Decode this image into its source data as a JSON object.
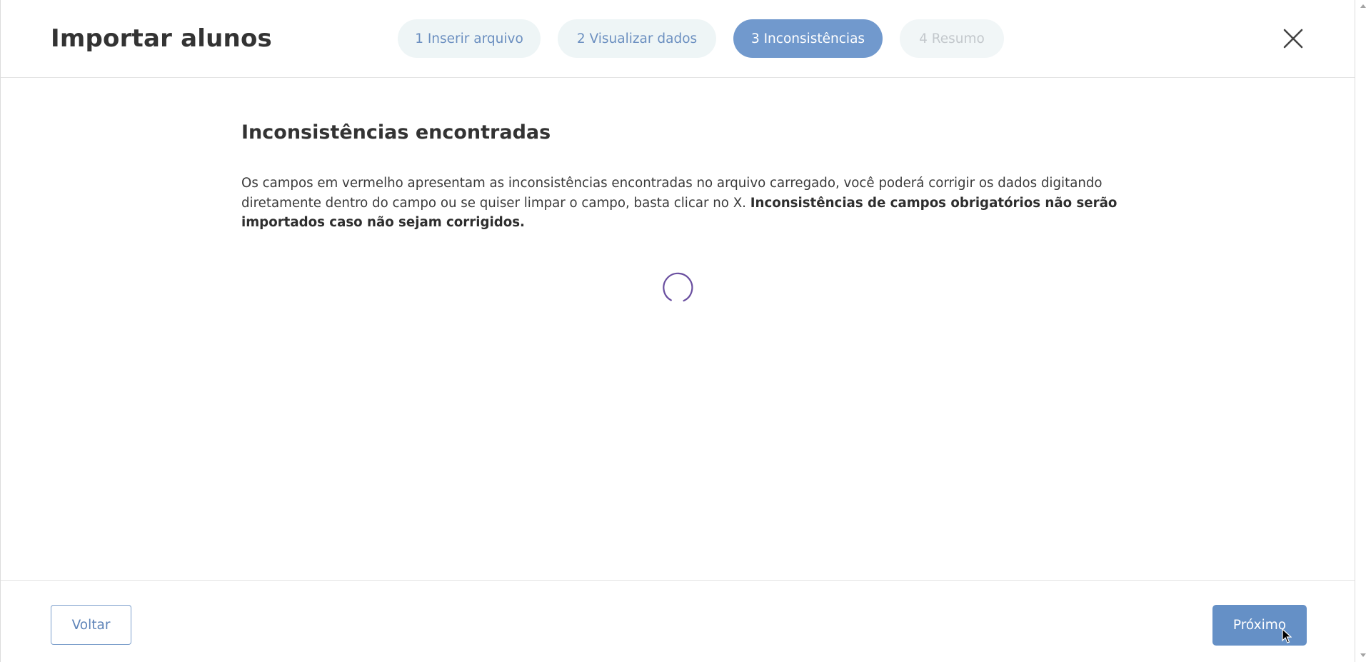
{
  "header": {
    "title": "Importar alunos",
    "steps": [
      {
        "label": "1 Inserir arquivo",
        "state": "completed"
      },
      {
        "label": "2 Visualizar dados",
        "state": "completed"
      },
      {
        "label": "3 Inconsistências",
        "state": "active"
      },
      {
        "label": "4 Resumo",
        "state": "disabled"
      }
    ],
    "close_icon": "close-icon"
  },
  "main": {
    "heading": "Inconsistências encontradas",
    "description": "Os campos em vermelho apresentam as inconsistências encontradas no arquivo carregado, você poderá corrigir os dados digitando diretamente dentro do campo ou se quiser limpar o campo, basta clicar no X. ",
    "description_bold": "Inconsistências de campos obrigatórios não serão importados caso não sejam corrigidos.",
    "loading_icon": "loading-spinner-icon"
  },
  "footer": {
    "back_label": "Voltar",
    "next_label": "Próximo"
  },
  "colors": {
    "accent": "#6590c6",
    "active_step": "#7199cd",
    "inactive_step_bg": "#eef5f6",
    "spinner": "#6a4fa0"
  }
}
